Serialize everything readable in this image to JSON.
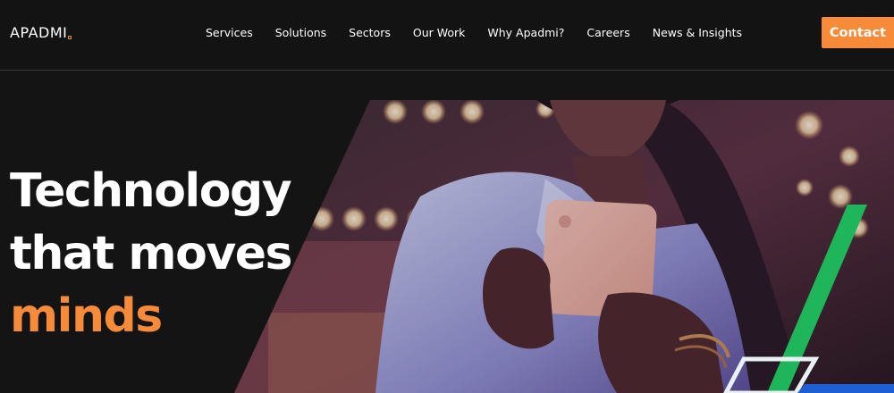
{
  "brand": {
    "name": "APADMI",
    "accent": "#f78b3a"
  },
  "nav": {
    "items": [
      {
        "label": "Services"
      },
      {
        "label": "Solutions"
      },
      {
        "label": "Sectors"
      },
      {
        "label": "Our Work"
      },
      {
        "label": "Why Apadmi?"
      },
      {
        "label": "Careers"
      },
      {
        "label": "News & Insights"
      }
    ],
    "contact_label": "Contact"
  },
  "hero": {
    "line1": "Technology",
    "line2": "that moves",
    "line3": "minds",
    "image_icon": "person-holding-phone-photo",
    "colors": {
      "highlight": "#f78b3a",
      "stripe_green": "#1fb55a",
      "stripe_blue": "#1f5fd6"
    }
  }
}
